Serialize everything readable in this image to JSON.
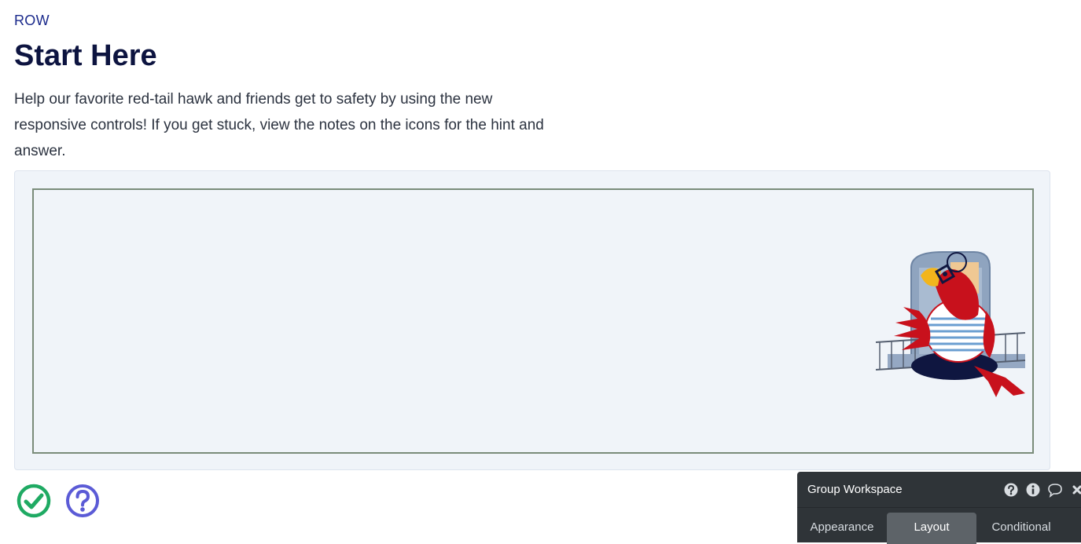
{
  "header": {
    "eyebrow": "ROW",
    "title": "Start Here",
    "intro": "Help our favorite red-tail hawk and friends get to safety by using the new responsive controls! If you get stuck, view the notes on the icons for the hint and answer."
  },
  "actions": {
    "check_icon": "check-circle-icon",
    "help_icon": "question-circle-icon"
  },
  "panel": {
    "title": "Group Workspace",
    "tools": [
      "question-circle-icon",
      "info-icon",
      "comment-icon",
      "close-icon"
    ],
    "tabs": [
      {
        "label": "Appearance",
        "active": false
      },
      {
        "label": "Layout",
        "active": true
      },
      {
        "label": "Conditional",
        "active": false
      }
    ]
  },
  "colors": {
    "title": "#0d1440",
    "eyebrow": "#1b2a8c",
    "check": "#1faa63",
    "help": "#5b5bd6",
    "panel_bg": "#2f3438",
    "active_tab": "#5d6368",
    "hawk_red": "#d0121b"
  }
}
